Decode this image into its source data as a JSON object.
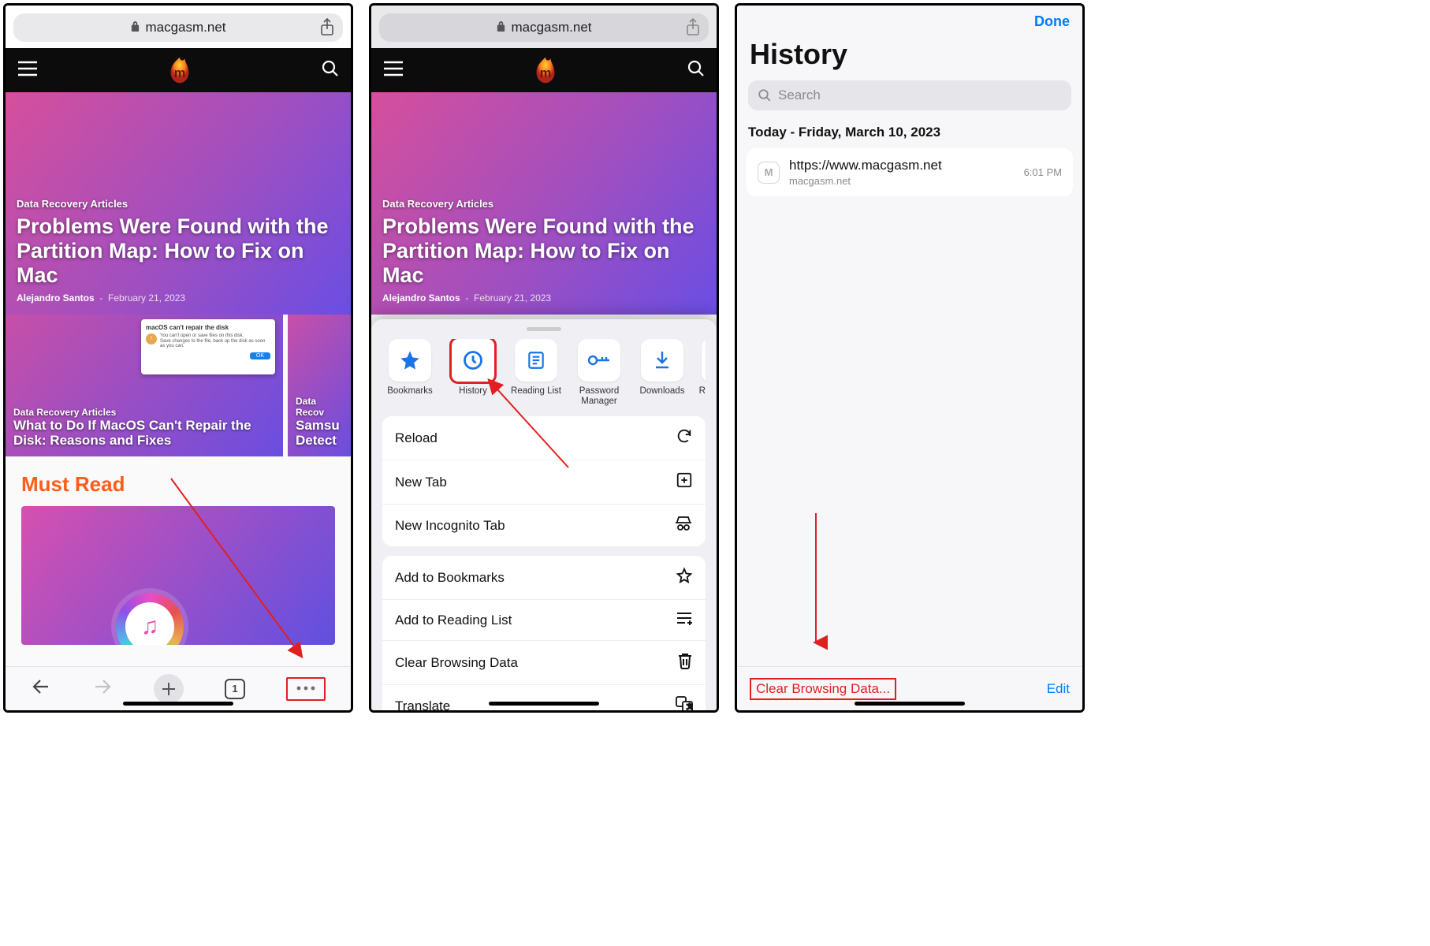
{
  "address": {
    "domain": "macgasm.net"
  },
  "hero": {
    "category": "Data Recovery Articles",
    "title": "Problems Were Found with the Partition Map: How to Fix on Mac",
    "author": "Alejandro Santos",
    "date": "February 21, 2023"
  },
  "thumb1": {
    "category": "Data Recovery Articles",
    "title": "What to Do If MacOS Can't Repair the Disk: Reasons and Fixes",
    "alert_title": "macOS can't repair the disk",
    "alert_ok": "OK"
  },
  "thumb2": {
    "category": "Data Recov",
    "title_a": "Samsu",
    "title_b": "Detect"
  },
  "mustread": {
    "heading": "Must Read"
  },
  "toolbar": {
    "tab_count": "1"
  },
  "quick": {
    "bookmarks": "Bookmarks",
    "history": "History",
    "reading": "Reading List",
    "password": "Password Manager",
    "downloads": "Downloads",
    "recent": "Rece"
  },
  "menu": {
    "reload": "Reload",
    "newtab": "New Tab",
    "incognito": "New Incognito Tab",
    "addbm": "Add to Bookmarks",
    "addrl": "Add to Reading List",
    "clear": "Clear Browsing Data",
    "translate": "Translate"
  },
  "p3": {
    "done": "Done",
    "title": "History",
    "search_ph": "Search",
    "date": "Today - Friday, March 10, 2023",
    "entry_url": "https://www.macgasm.net",
    "entry_domain": "macgasm.net",
    "entry_time": "6:01 PM",
    "entry_letter": "M",
    "clear": "Clear Browsing Data...",
    "edit": "Edit"
  }
}
